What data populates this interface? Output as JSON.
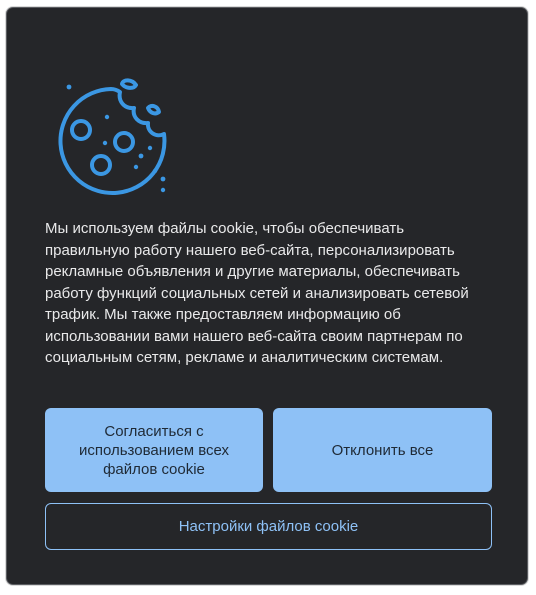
{
  "banner": {
    "message": "Мы используем файлы cookie, чтобы обеспечивать правильную работу нашего веб-сайта, персонализировать рекламные объявления и другие материалы, обеспечивать работу функций социальных сетей и анализировать сетевой трафик. Мы также предоставляем информацию об использовании вами нашего веб-сайта своим партнерам по социальным сетям, рекламе и аналитическим системам.",
    "icon": "cookie-icon",
    "accept_label": "Согласиться с использованием всех файлов cookie",
    "decline_label": "Отклонить все",
    "settings_label": "Настройки файлов cookie"
  },
  "colors": {
    "background": "#252629",
    "accent": "#8ec1f6",
    "icon": "#3b97e3",
    "text": "#e9e9ea"
  }
}
